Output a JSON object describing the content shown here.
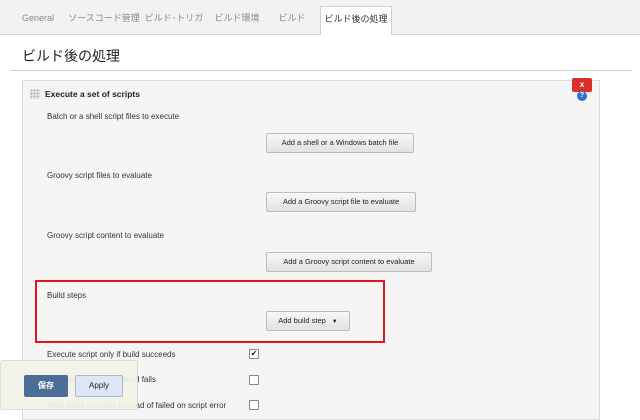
{
  "tabs": [
    {
      "label": "General"
    },
    {
      "label": "ソースコード管理"
    },
    {
      "label": "ビルド･トリガ"
    },
    {
      "label": "ビルド環境"
    },
    {
      "label": "ビルド"
    },
    {
      "label": "ビルド後の処理"
    }
  ],
  "section": {
    "title": "ビルド後の処理"
  },
  "panel": {
    "title": "Execute a set of scripts",
    "delete_label": "x",
    "help_label": "?",
    "fields": {
      "shell": {
        "label": "Batch or a shell script files to execute",
        "button": "Add a shell or a Windows batch file"
      },
      "groovy_files": {
        "label": "Groovy script files to evaluate",
        "button": "Add a Groovy script file to evaluate"
      },
      "groovy_content": {
        "label": "Groovy script content to evaluate",
        "button": "Add a Groovy script content to evaluate"
      },
      "build_steps": {
        "label": "Build steps",
        "button": "Add build step",
        "caret": "▼"
      }
    },
    "options": [
      {
        "label": "Execute script only if build succeeds",
        "checked": true,
        "mark": "✔"
      },
      {
        "label": "Execute script only if build fails",
        "checked": false,
        "mark": ""
      },
      {
        "label": "Mark build unstable instead of failed on script error",
        "checked": false,
        "mark": ""
      }
    ]
  },
  "actions": {
    "save": "保存",
    "apply": "Apply"
  },
  "colors": {
    "highlight": "#e2141c",
    "save_bg": "#4a6e95",
    "delete_bg": "#d9302b"
  }
}
